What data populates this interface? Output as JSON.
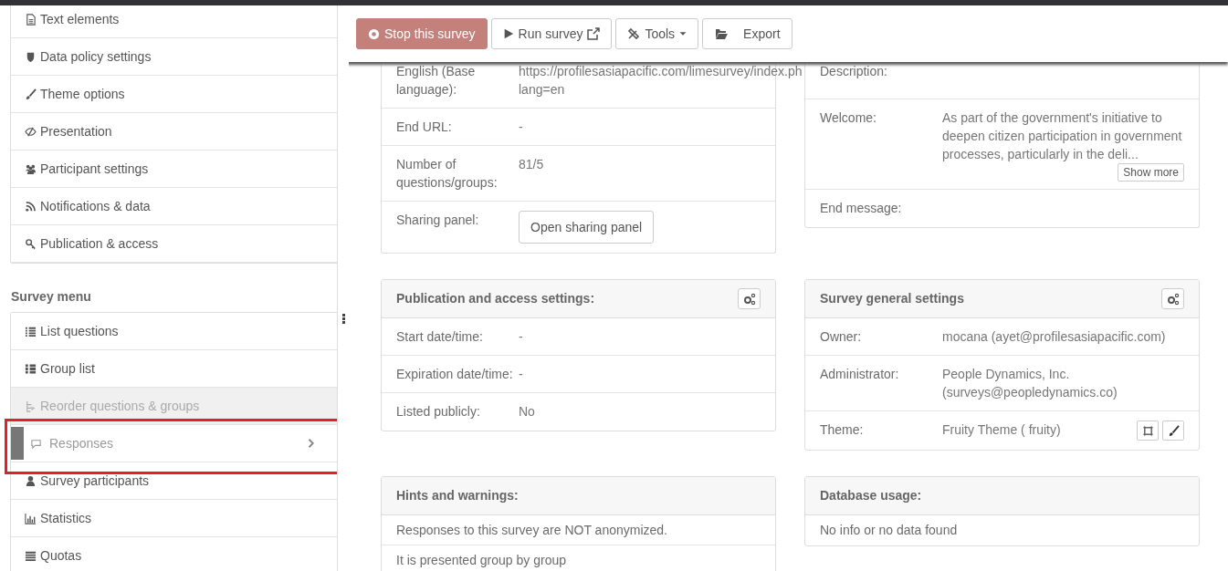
{
  "toolbar": {
    "buttons": [
      {
        "label": "Stop this survey",
        "kind": "stop"
      },
      {
        "label": "Run survey",
        "kind": "run"
      },
      {
        "label": "Tools",
        "kind": "dropdown"
      },
      {
        "label": "Export",
        "kind": "export"
      }
    ]
  },
  "sidebar": {
    "settings_items": [
      {
        "label": "Text elements"
      },
      {
        "label": "Data policy settings"
      },
      {
        "label": "Theme options"
      },
      {
        "label": "Presentation"
      },
      {
        "label": "Participant settings"
      },
      {
        "label": "Notifications & data"
      },
      {
        "label": "Publication & access"
      }
    ],
    "section_title": "Survey menu",
    "menu_items": [
      {
        "label": "List questions",
        "disabled": false,
        "selected": false,
        "highlighted": false
      },
      {
        "label": "Group list",
        "disabled": false,
        "selected": false,
        "highlighted": false
      },
      {
        "label": "Reorder questions & groups",
        "disabled": true,
        "selected": false,
        "highlighted": false
      },
      {
        "label": "Responses",
        "disabled": false,
        "selected": true,
        "highlighted": true
      },
      {
        "label": "Survey participants",
        "disabled": false,
        "selected": false,
        "highlighted": false
      },
      {
        "label": "Statistics",
        "disabled": false,
        "selected": false,
        "highlighted": false
      },
      {
        "label": "Quotas",
        "disabled": false,
        "selected": false,
        "highlighted": false
      }
    ]
  },
  "panels": [
    {
      "rows": [
        {
          "label": "English (Base language):",
          "value_lines": [
            "https://profilesasiapacific.com/limesurvey/index.ph",
            "lang=en"
          ]
        },
        {
          "label": "End URL:",
          "value": "-"
        },
        {
          "label": "Number of questions/groups:",
          "value": "81/5"
        },
        {
          "label": "Sharing panel:",
          "button": "Open sharing panel"
        }
      ]
    },
    {
      "rows": [
        {
          "label": "Description:"
        },
        {
          "label": "Welcome:",
          "value": "As part of the government's initiative to deepen citizen participation in government processes, particularly in the deli...",
          "button": "Show more"
        },
        {
          "label": "End message:"
        }
      ]
    },
    {
      "title": "Publication and access settings:",
      "settings_button": true,
      "rows": [
        {
          "label": "Start date/time:",
          "value": "-"
        },
        {
          "label": "Expiration date/time:",
          "value": "-"
        },
        {
          "label": "Listed publicly:",
          "value": "No"
        }
      ]
    },
    {
      "title": "Survey general settings",
      "settings_button": true,
      "rows": [
        {
          "label": "Owner:",
          "value": "mocana (ayet@profilesasiapacific.com)"
        },
        {
          "label": "Administrator:",
          "value": "People Dynamics, Inc. (surveys@peopledynamics.co)"
        },
        {
          "label": "Theme:",
          "value": "Fruity Theme ( fruity)",
          "theme_tools": true
        }
      ]
    },
    {
      "title": "Hints and warnings:",
      "settings_button": false,
      "rows": [
        {
          "text": "Responses to this survey are NOT anonymized."
        },
        {
          "text": "It is presented group by group"
        }
      ]
    },
    {
      "title": "Database usage:",
      "settings_button": false,
      "rows": [
        {
          "text": "No info or no data found"
        }
      ]
    }
  ]
}
